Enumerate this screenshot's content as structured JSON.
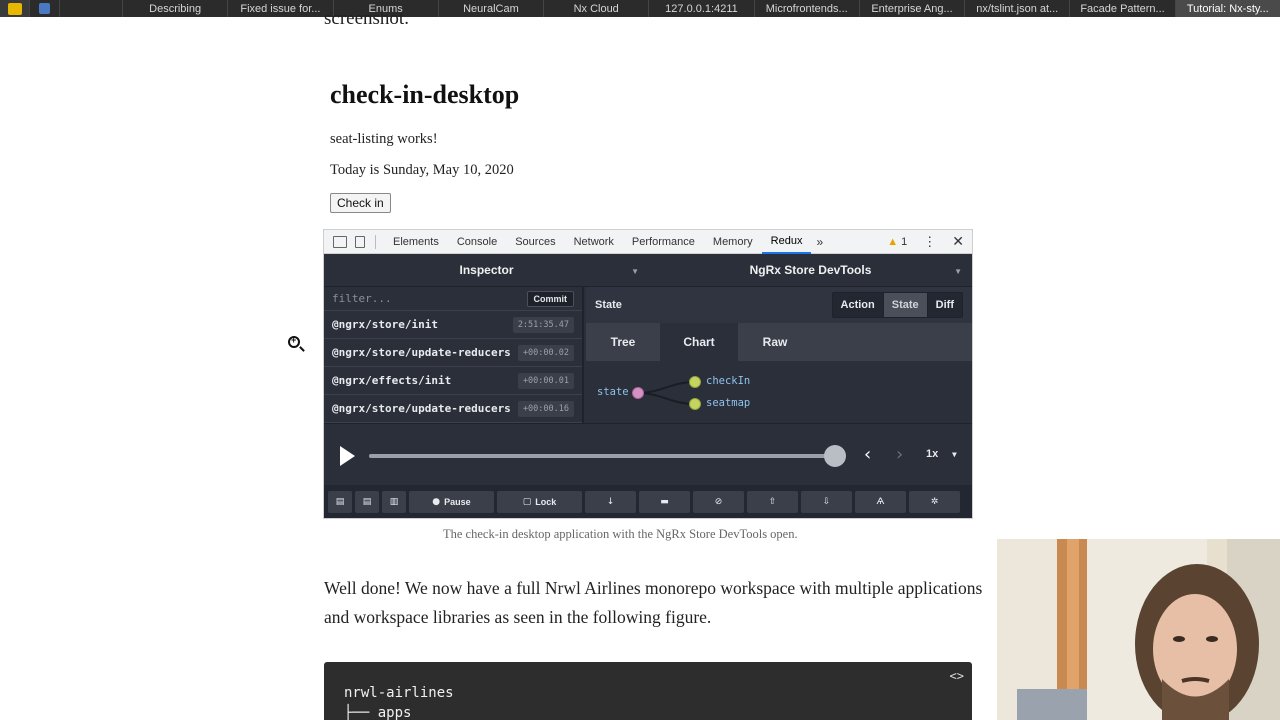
{
  "browser": {
    "tabs": [
      "Describing",
      "Fixed issue for...",
      "Enums",
      "NeuralCam",
      "Nx Cloud",
      "127.0.0.1:4211",
      "Microfrontends...",
      "Enterprise Ang...",
      "nx/tslint.json at...",
      "Facade Pattern...",
      "Tutorial: Nx-sty..."
    ]
  },
  "article": {
    "cut_line": "screenshot.",
    "demo": {
      "title": "check-in-desktop",
      "line1": "seat-listing works!",
      "line2": "Today is Sunday, May 10, 2020",
      "button": "Check in"
    },
    "caption": "The check-in desktop application with the NgRx Store DevTools open.",
    "paragraph": "Well done! We now have a full Nrwl Airlines monorepo workspace with multiple applications and workspace libraries as seen in the following figure.",
    "code": {
      "line1": "nrwl-airlines",
      "line2": "├── apps",
      "toggle": "<>"
    }
  },
  "devtools": {
    "tabs": [
      "Elements",
      "Console",
      "Sources",
      "Network",
      "Performance",
      "Memory",
      "Redux"
    ],
    "active_tab": "Redux",
    "more": "»",
    "warning_count": "1",
    "kebab": "⋮",
    "close": "✕"
  },
  "redux": {
    "inspector_title": "Inspector",
    "monitor_title": "NgRx Store DevTools",
    "filter_placeholder": "filter...",
    "commit": "Commit",
    "actions": [
      {
        "name": "@ngrx/store/init",
        "time": "2:51:35.47"
      },
      {
        "name": "@ngrx/store/update-reducers",
        "time": "+00:00.02"
      },
      {
        "name": "@ngrx/effects/init",
        "time": "+00:00.01"
      },
      {
        "name": "@ngrx/store/update-reducers",
        "time": "+00:00.16"
      }
    ],
    "state_label": "State",
    "modes": [
      "Action",
      "State",
      "Diff"
    ],
    "active_mode": "State",
    "view_tabs": [
      "Tree",
      "Chart",
      "Raw"
    ],
    "active_view": "Chart",
    "chart": {
      "root": "state",
      "children": [
        "checkIn",
        "seatmap"
      ],
      "colors": {
        "root": "#d690c6",
        "child": "#c3d55e",
        "link": "#1a1d24"
      }
    },
    "player": {
      "speed": "1x",
      "progress": 1.0
    },
    "bottom_buttons": {
      "pause": "Pause",
      "lock": "Lock"
    }
  }
}
